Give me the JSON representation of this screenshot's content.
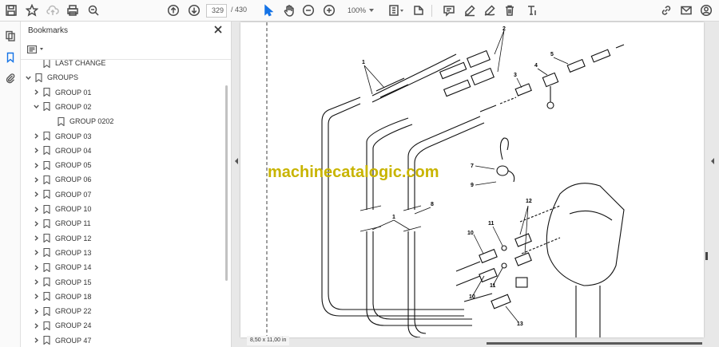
{
  "toolbar": {
    "page_current": "329",
    "page_total": "/ 430",
    "zoom": "100%"
  },
  "panel": {
    "title": "Bookmarks"
  },
  "bookmarks": [
    {
      "label": "LAST CHANGE",
      "level": 1,
      "chevron": "none"
    },
    {
      "label": "GROUPS",
      "level": 0,
      "chevron": "down"
    },
    {
      "label": "GROUP 01",
      "level": 1,
      "chevron": "right"
    },
    {
      "label": "GROUP 02",
      "level": 1,
      "chevron": "down"
    },
    {
      "label": "GROUP 0202",
      "level": 2,
      "chevron": "none"
    },
    {
      "label": "GROUP 03",
      "level": 1,
      "chevron": "right"
    },
    {
      "label": "GROUP 04",
      "level": 1,
      "chevron": "right"
    },
    {
      "label": "GROUP 05",
      "level": 1,
      "chevron": "right"
    },
    {
      "label": "GROUP 06",
      "level": 1,
      "chevron": "right"
    },
    {
      "label": "GROUP 07",
      "level": 1,
      "chevron": "right"
    },
    {
      "label": "GROUP 10",
      "level": 1,
      "chevron": "right"
    },
    {
      "label": "GROUP 11",
      "level": 1,
      "chevron": "right"
    },
    {
      "label": "GROUP 12",
      "level": 1,
      "chevron": "right"
    },
    {
      "label": "GROUP 13",
      "level": 1,
      "chevron": "right"
    },
    {
      "label": "GROUP 14",
      "level": 1,
      "chevron": "right"
    },
    {
      "label": "GROUP 15",
      "level": 1,
      "chevron": "right"
    },
    {
      "label": "GROUP 18",
      "level": 1,
      "chevron": "right"
    },
    {
      "label": "GROUP 22",
      "level": 1,
      "chevron": "right"
    },
    {
      "label": "GROUP 24",
      "level": 1,
      "chevron": "right"
    },
    {
      "label": "GROUP 47",
      "level": 1,
      "chevron": "right"
    }
  ],
  "document": {
    "watermark": "machinecatalogic.com",
    "page_size": "8,50 x 11,00 in",
    "callouts": [
      "1",
      "2",
      "3",
      "4",
      "5",
      "1",
      "8",
      "7",
      "9",
      "10",
      "11",
      "12",
      "10",
      "11",
      "13"
    ]
  },
  "colors": {
    "accent": "#1473e6",
    "watermark": "#c8b400"
  }
}
